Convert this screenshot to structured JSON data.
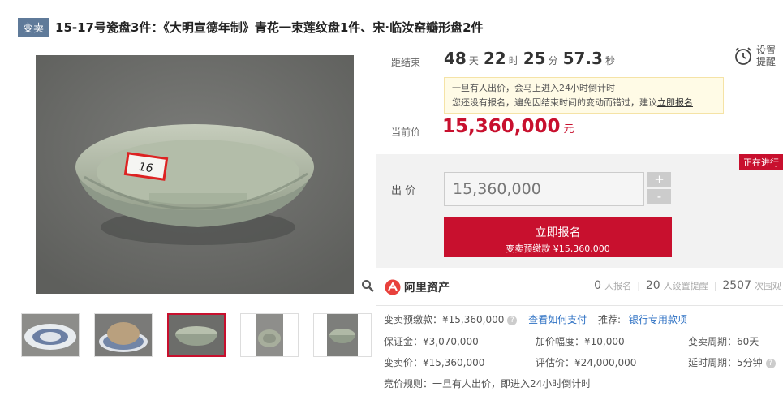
{
  "header": {
    "tag": "变卖",
    "title": "15-17号瓷盘3件：《大明宣德年制》青花一束莲纹盘1件、宋·临汝窑瓣形盘2件"
  },
  "countdown": {
    "label": "距结束",
    "days": "48",
    "days_unit": "天",
    "hours": "22",
    "hours_unit": "时",
    "minutes": "25",
    "minutes_unit": "分",
    "seconds": "57.3",
    "seconds_unit": "秒"
  },
  "reminder": {
    "label": "设置提醒",
    "icon": "alarm-clock-icon"
  },
  "notice": {
    "line1": "一旦有人出价，会马上进入24小时倒计时",
    "line2_prefix": "您还没有报名，遍免因结束时间的变动而错过，建议",
    "line2_link": "立即报名"
  },
  "current_price": {
    "label": "当前价",
    "value": "15,360,000",
    "unit": "元"
  },
  "bid": {
    "status": "正在进行",
    "label": "出 价",
    "input_value": "15,360,000",
    "plus": "+",
    "minus": "-",
    "signup_label": "立即报名",
    "signup_sub": "变卖预缴款 ¥15,360,000"
  },
  "platform": {
    "name": "阿里资产",
    "logo_icon": "ali-asset-logo-icon"
  },
  "stats": {
    "signups": "0",
    "signups_label": "人报名",
    "reminders": "20",
    "reminders_label": "人设置提醒",
    "views": "2507",
    "views_label": "次围观"
  },
  "info": {
    "deposit_label": "变卖预缴款：¥15,360,000",
    "how_to_pay": "查看如何支付",
    "recommend_label": "推荐:",
    "bank_link": "银行专用款项",
    "guarantee": "保证金：¥3,070,000",
    "increment": "加价幅度：¥10,000",
    "period": "变卖周期：60天",
    "sale_price": "变卖价：¥15,360,000",
    "appraisal": "评估价：¥24,000,000",
    "extension": "延时周期：5分钟",
    "rules": "竞价规则：一旦有人出价，即进入24小时倒计时"
  },
  "gallery": {
    "sticker_text": "16",
    "thumbnails": [
      "blue-white-plate",
      "rust-bowl-on-plate",
      "celadon-bowl",
      "celadon-bowl-top",
      "celadon-bowl-side"
    ],
    "selected_index": 2
  },
  "colors": {
    "accent": "#c8102e",
    "badge": "#5f7a99",
    "link": "#2f72c4",
    "notice_bg": "#fffbe6"
  }
}
